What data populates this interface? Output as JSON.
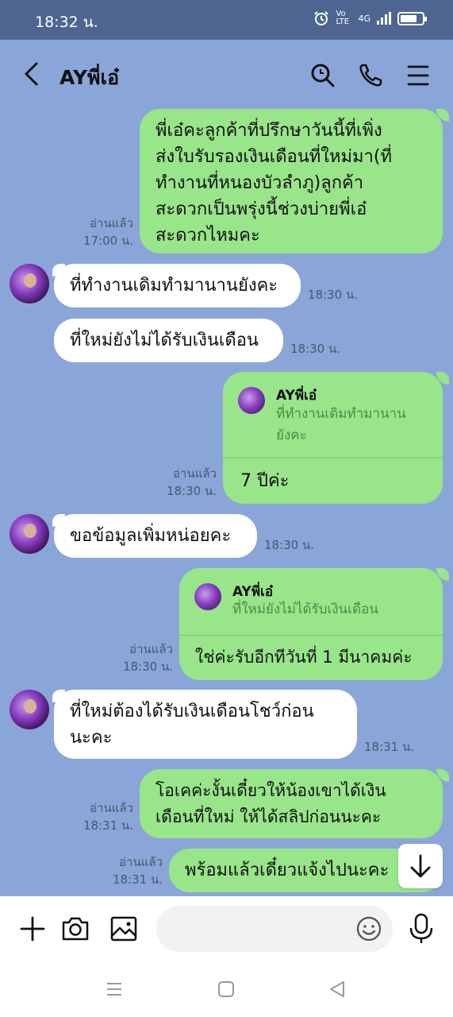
{
  "status_bar": {
    "time": "18:32 น.",
    "network_label": "4G",
    "volte_label": "Vo LTE"
  },
  "header": {
    "title": "AYพี่เอ๋",
    "icons": [
      "back-icon",
      "search-icon",
      "phone-icon",
      "menu-icon"
    ]
  },
  "messages": [
    {
      "side": "out",
      "text_lines": [
        "พี่เอ๋คะลูกค้าที่ปรึกษาวันนี้ที่เพิ่ง",
        "ส่งใบรับรองเงินเดือนที่ใหม่มา(ที่",
        "ทำงานที่หนองบัวลำภู)ลูกค้า",
        "สะดวกเป็นพรุ่งนี้ช่วงบ่ายพี่เอ๋",
        "สะดวกไหมคะ"
      ],
      "read": "อ่านแล้ว",
      "time": "17:00 น."
    },
    {
      "side": "in",
      "text": "ที่ทำงานเดิมทำมานานยังคะ",
      "time": "18:30 น."
    },
    {
      "side": "in",
      "text": "ที่ใหม่ยังไม่ได้รับเงินเดือน",
      "time": "18:30 น."
    },
    {
      "side": "out",
      "reply_to": {
        "name": "AYพี่เอ๋",
        "quote_lines": [
          "ที่ทำงานเดิมทำมานาน",
          "ยังคะ"
        ]
      },
      "text": "7 ปีค่ะ",
      "read": "อ่านแล้ว",
      "time": "18:30 น."
    },
    {
      "side": "in",
      "text": "ขอข้อมูลเพิ่มหน่อยคะ",
      "time": "18:30 น."
    },
    {
      "side": "out",
      "reply_to": {
        "name": "AYพี่เอ๋",
        "quote_lines": [
          "ที่ใหม่ยังไม่ได้รับเงินเดือน"
        ]
      },
      "text": "ใช่ค่ะรับอีกทีวันที่ 1 มีนาคมค่ะ",
      "read": "อ่านแล้ว",
      "time": "18:30 น."
    },
    {
      "side": "in",
      "text_lines": [
        "ที่ใหม่ต้องได้รับเงินเดือนโชว์ก่อน",
        "นะคะ"
      ],
      "time": "18:31 น."
    },
    {
      "side": "out",
      "text_lines": [
        "โอเคค่ะงั้นเดี๋ยวให้น้องเขาได้เงิน",
        "เดือนที่ใหม่ ให้ได้สลิปก่อนนะคะ"
      ],
      "read": "อ่านแล้ว",
      "time": "18:31 น."
    },
    {
      "side": "out",
      "text": "พร้อมแล้วเดี๋ยวแจ้งไปนะคะ",
      "read": "อ่านแล้ว",
      "time": "18:31 น."
    }
  ],
  "input": {
    "icons": [
      "plus-icon",
      "camera-icon",
      "image-icon",
      "emoji-icon",
      "microphone-icon"
    ]
  },
  "colors": {
    "status_bar": "#4e6592",
    "chat_background": "#8aa6d8",
    "outgoing_bubble": "#99e58a",
    "incoming_bubble": "#ffffff",
    "quote_text": "#4d8a47"
  }
}
